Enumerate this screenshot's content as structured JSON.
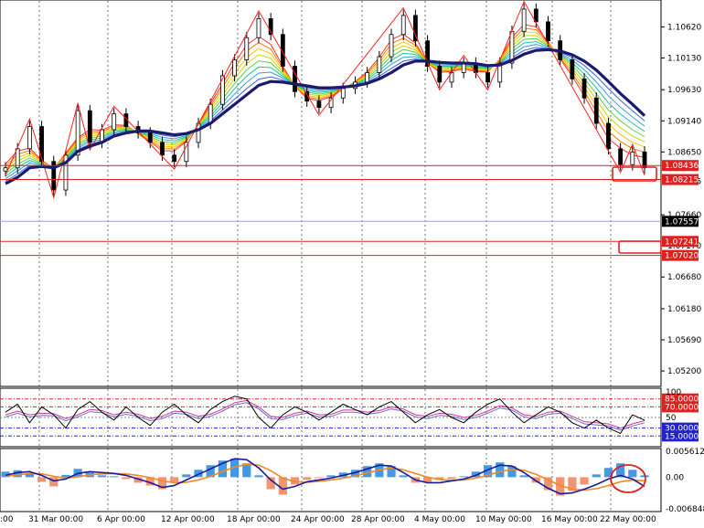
{
  "chart_data": [
    {
      "type": "line",
      "panel": "price",
      "ylim": [
        1.05,
        1.11
      ],
      "y_ticks": [
        "1.10620",
        "1.10130",
        "1.09630",
        "1.09140",
        "1.08650",
        "1.07660",
        "1.06680",
        "1.06180",
        "1.05690",
        "1.05200"
      ],
      "current_price": "1.07557",
      "levels": [
        {
          "label": "1.08436",
          "value": 1.08436
        },
        {
          "label": "1.08215",
          "value": 1.08215
        },
        {
          "label": "1.07241",
          "value": 1.07241
        },
        {
          "label": "1.07020",
          "value": 1.0702
        }
      ],
      "level_partial_labels": [
        "1.08215",
        "1.07170"
      ],
      "x_labels": [
        "31 Mar 00:00",
        "6 Apr 00:00",
        "12 Apr 00:00",
        "18 Apr 00:00",
        "24 Apr 00:00",
        "28 Apr 00:00",
        "4 May 00:00",
        "10 May 00:00",
        "16 May 00:00",
        "22 May 00:00"
      ],
      "x_label_partial": ":00",
      "x_index": [
        0,
        4,
        8,
        12,
        16,
        20,
        24,
        28,
        32,
        36,
        40,
        44,
        48,
        52,
        56,
        60,
        64,
        68,
        72,
        76,
        80,
        84,
        88,
        92,
        96,
        100,
        104,
        108,
        112,
        116,
        120,
        124,
        128,
        132,
        136,
        140,
        144,
        148,
        152,
        156,
        160,
        164,
        168,
        172,
        176,
        180,
        184,
        188,
        192,
        196,
        200,
        204,
        208,
        212
      ],
      "close": [
        1.084,
        1.087,
        1.0905,
        1.085,
        1.0805,
        1.086,
        1.093,
        1.088,
        1.09,
        1.0925,
        1.0905,
        1.0895,
        1.088,
        1.086,
        1.085,
        1.088,
        1.091,
        1.094,
        1.0985,
        1.101,
        1.1045,
        1.1075,
        1.105,
        1.1,
        1.096,
        1.0945,
        1.0935,
        1.095,
        1.0965,
        1.0975,
        1.099,
        1.1015,
        1.105,
        1.108,
        1.104,
        1.1,
        1.0975,
        1.099,
        1.1005,
        1.099,
        1.0975,
        1.1005,
        1.1055,
        1.109,
        1.107,
        1.104,
        1.101,
        1.098,
        1.095,
        1.091,
        1.087,
        1.0845,
        1.0865,
        1.084
      ],
      "ma_slow": [
        1.0815,
        1.0825,
        1.084,
        1.0842,
        1.084,
        1.0848,
        1.0866,
        1.0874,
        1.088,
        1.089,
        1.0895,
        1.0898,
        1.0898,
        1.0895,
        1.0892,
        1.0894,
        1.09,
        1.091,
        1.0925,
        1.094,
        1.0955,
        1.097,
        1.0976,
        1.0975,
        1.0972,
        1.0969,
        1.0966,
        1.0966,
        1.0967,
        1.0969,
        1.0973,
        1.098,
        1.099,
        1.1002,
        1.1008,
        1.1008,
        1.1006,
        1.1005,
        1.1005,
        1.1004,
        1.1001,
        1.1002,
        1.1009,
        1.1019,
        1.1025,
        1.1026,
        1.1024,
        1.1018,
        1.1008,
        1.0994,
        1.0976,
        1.0957,
        1.094,
        1.0922
      ]
    },
    {
      "type": "line",
      "panel": "stochastic",
      "ylim": [
        0,
        100
      ],
      "y_tick_labels": [
        "100",
        "50"
      ],
      "levels": [
        {
          "label": "85.0000",
          "value": 85,
          "color": "#dd2222"
        },
        {
          "label": "70.0000",
          "value": 70,
          "color": "#dd2222"
        },
        {
          "label": "30.0000",
          "value": 30,
          "color": "#2222cc"
        },
        {
          "label": "15.0000",
          "value": 15,
          "color": "#2222cc"
        }
      ],
      "main": [
        60,
        75,
        40,
        70,
        55,
        30,
        65,
        80,
        60,
        45,
        70,
        50,
        35,
        60,
        75,
        55,
        40,
        65,
        80,
        90,
        85,
        50,
        30,
        55,
        70,
        60,
        45,
        60,
        75,
        65,
        55,
        70,
        80,
        60,
        40,
        55,
        65,
        50,
        40,
        60,
        75,
        85,
        60,
        40,
        55,
        70,
        60,
        40,
        30,
        45,
        30,
        20,
        55,
        45
      ],
      "signal": [
        55,
        62,
        55,
        58,
        57,
        48,
        55,
        65,
        63,
        55,
        60,
        56,
        48,
        52,
        62,
        60,
        52,
        56,
        66,
        78,
        82,
        70,
        52,
        50,
        58,
        62,
        55,
        56,
        64,
        64,
        60,
        63,
        70,
        66,
        55,
        52,
        58,
        56,
        50,
        54,
        62,
        72,
        68,
        55,
        52,
        60,
        62,
        52,
        42,
        40,
        38,
        30,
        38,
        44
      ]
    },
    {
      "type": "bar",
      "panel": "macd",
      "ylim": [
        -0.0068484,
        0.0056125
      ],
      "y_tick_labels": [
        "0.0056125",
        "0.00",
        "-0.0068484"
      ],
      "histogram": [
        0.0012,
        0.0015,
        0.0008,
        -0.001,
        -0.002,
        0.0005,
        0.0018,
        0.001,
        0.0004,
        0.0002,
        -0.0004,
        -0.0012,
        -0.0018,
        -0.0026,
        -0.001,
        0.0006,
        0.0016,
        0.0026,
        0.0036,
        0.004,
        0.003,
        0.0004,
        -0.0026,
        -0.0038,
        -0.0016,
        -0.0006,
        -0.0002,
        0.0004,
        0.001,
        0.0016,
        0.0024,
        0.003,
        0.0024,
        0.0004,
        -0.0012,
        -0.001,
        -0.0006,
        -0.0004,
        0.0002,
        0.0012,
        0.0026,
        0.0032,
        0.0024,
        0.0004,
        -0.0012,
        -0.0028,
        -0.004,
        -0.003,
        -0.0016,
        0.0006,
        0.002,
        0.003,
        0.0016,
        0.0004
      ],
      "macd_line": [
        0.0004,
        0.001,
        0.0012,
        0.0004,
        -0.0008,
        -0.0004,
        0.0008,
        0.0012,
        0.001,
        0.0008,
        0.0004,
        -0.0004,
        -0.0012,
        -0.0022,
        -0.0018,
        -0.0006,
        0.0006,
        0.0018,
        0.003,
        0.004,
        0.0038,
        0.002,
        -0.0006,
        -0.0026,
        -0.002,
        -0.001,
        -0.0006,
        -0.0002,
        0.0004,
        0.001,
        0.0018,
        0.0026,
        0.0024,
        0.001,
        -0.0006,
        -0.0012,
        -0.0012,
        -0.0008,
        -0.0004,
        0.0004,
        0.0016,
        0.0026,
        0.0024,
        0.001,
        -0.0008,
        -0.0024,
        -0.0036,
        -0.0034,
        -0.0026,
        -0.0016,
        -0.0004,
        0.0004,
        -0.0004,
        -0.002
      ],
      "signal_line": [
        0.0002,
        0.0005,
        0.0008,
        0.0007,
        0.0002,
        -0.0002,
        0.0001,
        0.0005,
        0.0007,
        0.0008,
        0.0007,
        0.0004,
        -0.0001,
        -0.0008,
        -0.0012,
        -0.0011,
        -0.0006,
        0.0002,
        0.0012,
        0.0022,
        0.0028,
        0.0026,
        0.0014,
        -0.0002,
        -0.001,
        -0.0011,
        -0.0009,
        -0.0006,
        -0.0002,
        0.0003,
        0.0009,
        0.0016,
        0.002,
        0.0016,
        0.0008,
        0.0,
        -0.0005,
        -0.0007,
        -0.0006,
        -0.0002,
        0.0004,
        0.0012,
        0.0017,
        0.0015,
        0.0006,
        -0.0006,
        -0.0018,
        -0.0026,
        -0.0028,
        -0.0025,
        -0.0018,
        -0.001,
        -0.0006,
        -0.0008
      ]
    }
  ],
  "colors": {
    "ma_slow": "#1b1b6e",
    "level_line": "#e02020",
    "level_box": "#e02020",
    "current_box": "#000000",
    "current_line": "#9aa6d8",
    "zigzag": "#ff2020",
    "stoch_main": "#000000",
    "stoch_signal_1": "#cc3b8c",
    "stoch_signal_2": "#6b6bd6",
    "macd_pos": "#2f8fe0",
    "macd_neg": "#f08a60",
    "macd_line": "#1b1b9e",
    "signal_line": "#f08a20",
    "annotation": "#e02020",
    "grid": "#000000"
  },
  "ribbon_colors": [
    "#ff3030",
    "#ff7a00",
    "#ffc400",
    "#c9d400",
    "#5fd040",
    "#20c0a0",
    "#2fa0e0",
    "#4060d0"
  ]
}
